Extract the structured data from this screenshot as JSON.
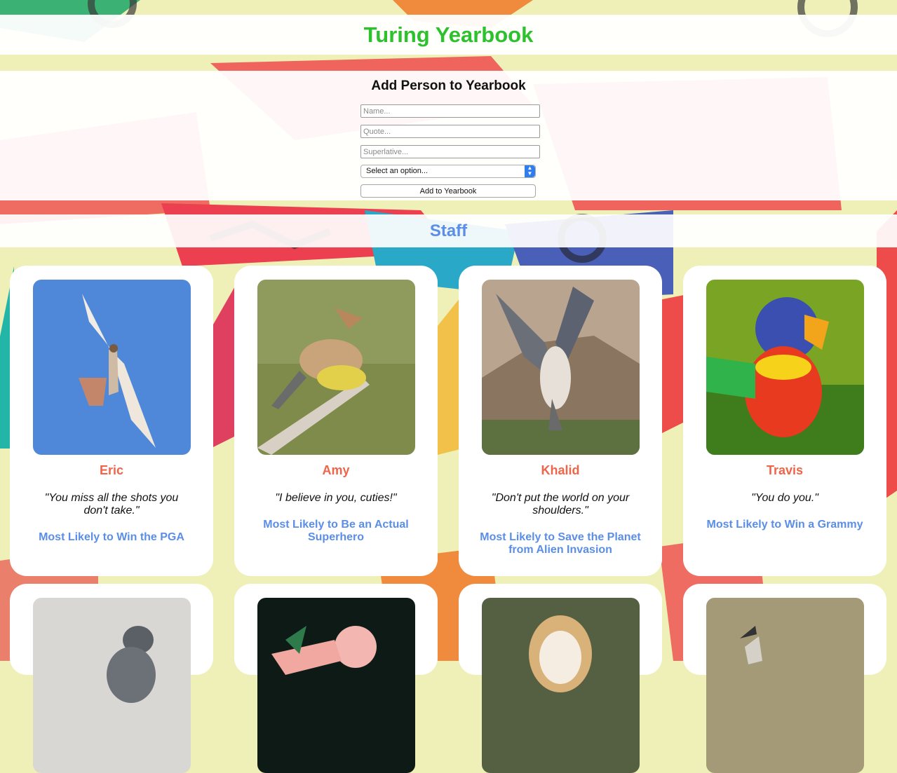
{
  "app": {
    "title": "Turing Yearbook"
  },
  "form": {
    "heading": "Add Person to Yearbook",
    "name_placeholder": "Name...",
    "quote_placeholder": "Quote...",
    "superlative_placeholder": "Superlative...",
    "select_value": "Select an option...",
    "submit_label": "Add to Yearbook"
  },
  "section": {
    "title": "Staff"
  },
  "people": [
    {
      "name": "Eric",
      "quote": "\"You miss all the shots you don't take.\"",
      "superlative": "Most Likely to Win the PGA",
      "photo": "red-tailed-hawk"
    },
    {
      "name": "Amy",
      "quote": "\"I believe in you, cuties!\"",
      "superlative": "Most Likely to Be an Actual Superhero",
      "photo": "cedar-waxwing"
    },
    {
      "name": "Khalid",
      "quote": "\"Don't put the world on your shoulders.\"",
      "superlative": "Most Likely to Save the Planet from Alien Invasion",
      "photo": "peregrine-falcon"
    },
    {
      "name": "Travis",
      "quote": "\"You do you.\"",
      "superlative": "Most Likely to Win a Grammy",
      "photo": "rainbow-lorikeet"
    }
  ],
  "next_row_photos": [
    "pigeon",
    "flamingo",
    "barn-owl",
    "secretary-bird"
  ],
  "colors": {
    "title_green": "#2ec12e",
    "name_red": "#f06449",
    "accent_blue": "#5b8ee6"
  }
}
